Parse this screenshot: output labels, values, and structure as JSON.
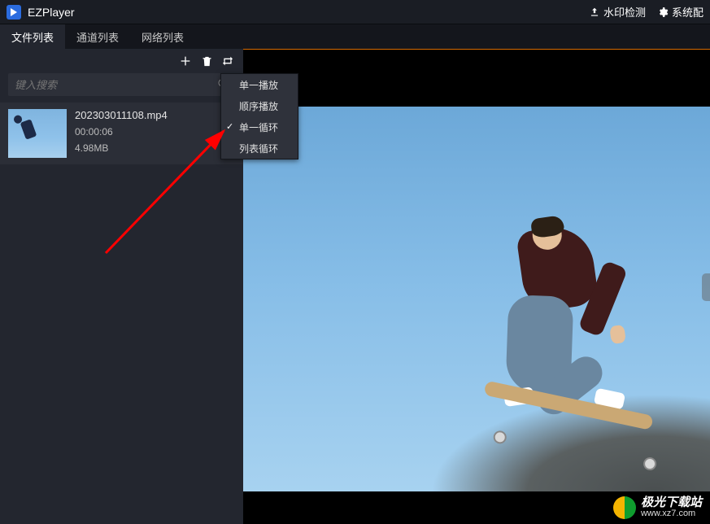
{
  "header": {
    "app_title": "EZPlayer",
    "watermark_btn": "水印检测",
    "settings_btn": "系统配"
  },
  "tabs": {
    "file_list": "文件列表",
    "channel_list": "通道列表",
    "network_list": "网络列表"
  },
  "search": {
    "placeholder": "键入搜索"
  },
  "file": {
    "name": "202303011108.mp4",
    "duration": "00:00:06",
    "size": "4.98MB"
  },
  "playback_menu": {
    "single_play": "单一播放",
    "sequential": "顺序播放",
    "single_loop": "单一循环",
    "list_loop": "列表循环",
    "selected": "single_loop"
  },
  "watermark": {
    "site_cn": "极光下载站",
    "site_url": "www.xz7.com"
  }
}
